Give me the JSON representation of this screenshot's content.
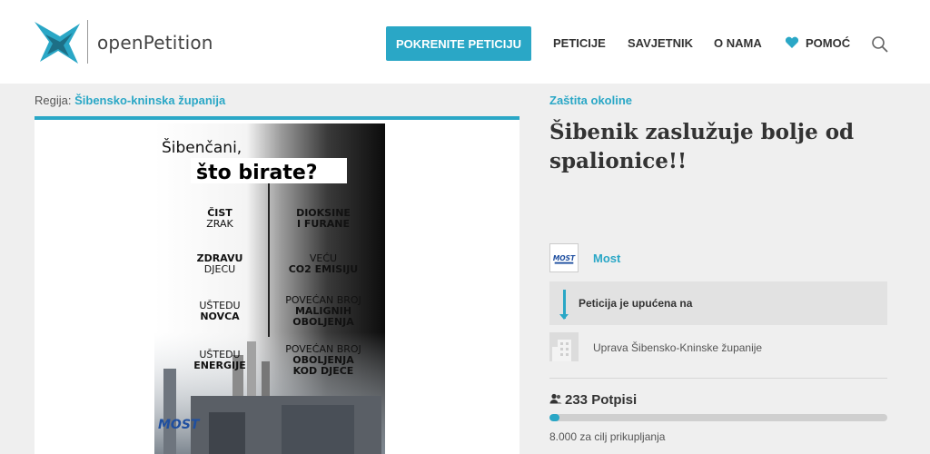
{
  "header": {
    "logo_text": "openPetition",
    "cta_label": "POKRENITE PETICIJU",
    "nav": [
      "PETICIJE",
      "SAVJETNIK",
      "O NAMA",
      "POMOĆ"
    ],
    "icons": [
      "logo-icon",
      "heart-icon",
      "search-icon"
    ]
  },
  "region": {
    "label": "Regija:",
    "value": "Šibensko-kninska županija"
  },
  "poster": {
    "line1": "Šibenčani,",
    "line2": "što birate?",
    "left": [
      [
        "ČIST",
        "ZRAK"
      ],
      [
        "ZDRAVU",
        "DJECU"
      ],
      [
        "UŠTEDU",
        "NOVCA"
      ],
      [
        "UŠTEDU",
        "ENERGIJE"
      ]
    ],
    "right": [
      [
        "DIOKSINE",
        "I FURANE"
      ],
      [
        "VEĆU",
        "CO2 EMISIJU"
      ],
      [
        "POVEĆAN BROJ",
        "MALIGNIH",
        "OBOLJENJA"
      ],
      [
        "POVEĆAN BROJ",
        "OBOLJENJA",
        "KOD DJECE"
      ]
    ],
    "brand": "MOST"
  },
  "petition": {
    "category": "Zaštita okoline",
    "title": "Šibenik zaslužuje bolje od spalionice!!",
    "author": "Most",
    "addressed_label": "Peticija je upućena na",
    "recipient": "Uprava Šibensko-Kninske županije",
    "signatures": "233 Potpisi",
    "progress_fraction": 0.029,
    "goal": "8.000 za cilj prikupljanja"
  },
  "colors": {
    "accent": "#2aa7c6",
    "background": "#efefef"
  }
}
